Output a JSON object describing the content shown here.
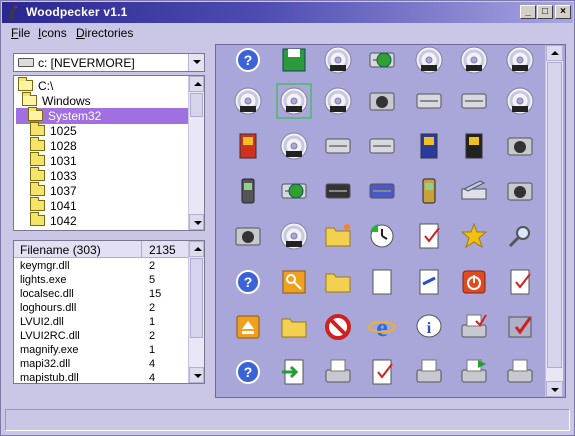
{
  "window": {
    "title": "Woodpecker v1.1",
    "minimize": "_",
    "maximize": "□",
    "close": "×"
  },
  "menu": [
    {
      "accel": "F",
      "rest": "ile"
    },
    {
      "accel": "I",
      "rest": "cons"
    },
    {
      "accel": "D",
      "rest": "irectories"
    }
  ],
  "drive": {
    "value": "c: [NEVERMORE]",
    "icon": "hard-drive-icon"
  },
  "directories": [
    "C:\\",
    "Windows",
    "System32",
    "1025",
    "1028",
    "1031",
    "1033",
    "1037",
    "1041",
    "1042"
  ],
  "selected_directory": "System32",
  "files": {
    "header_name": "Filename (303)",
    "header_count": "2135",
    "rows": [
      {
        "name": "keymgr.dll",
        "count": "2"
      },
      {
        "name": "lights.exe",
        "count": "5"
      },
      {
        "name": "localsec.dll",
        "count": "15"
      },
      {
        "name": "loghours.dll",
        "count": "2"
      },
      {
        "name": "LVUI2.dll",
        "count": "1"
      },
      {
        "name": "LVUI2RC.dll",
        "count": "2"
      },
      {
        "name": "magnify.exe",
        "count": "1"
      },
      {
        "name": "mapi32.dll",
        "count": "4"
      },
      {
        "name": "mapistub.dll",
        "count": "4"
      }
    ]
  },
  "icons": [
    [
      "help-icon",
      "save-icon",
      "dvd-drive-icon",
      "network-add-icon",
      "cd-icon",
      "cdrom-icon",
      "cdr-icon"
    ],
    [
      "cdrw-icon",
      "dvdram-icon",
      "dvdr-icon",
      "scanner-camera-icon",
      "tape-drive-icon",
      "drive-icon",
      "cd-icon"
    ],
    [
      "removable-red-icon",
      "dvdrom-icon",
      "floppy-drive-icon",
      "disk-unit-icon",
      "smart-card-icon",
      "memory-card-icon",
      "camera-icon"
    ],
    [
      "phone-icon",
      "printer-network-icon",
      "zip-drive-icon",
      "drive-blue-icon",
      "pda-icon",
      "scanner-icon",
      "camera-small-icon"
    ],
    [
      "camcorder-icon",
      "dvdrw-icon",
      "folder-star-icon",
      "clock-icon",
      "tasks-icon",
      "star-icon",
      "search-icon"
    ],
    [
      "help-circle-icon",
      "key-icon",
      "program-folder-icon",
      "time-document-icon",
      "window-arrow-icon",
      "power-icon",
      "checklist-icon"
    ],
    [
      "eject-icon",
      "find-folder-icon",
      "no-entry-icon",
      "internet-explorer-icon",
      "info-icon",
      "printer-check-icon",
      "shield-check-icon"
    ],
    [
      "help-document-icon",
      "export-document-icon",
      "printer-doc-icon",
      "document-check-icon",
      "printer-icon",
      "printer-arrow-icon",
      "fax-printer-icon"
    ]
  ]
}
